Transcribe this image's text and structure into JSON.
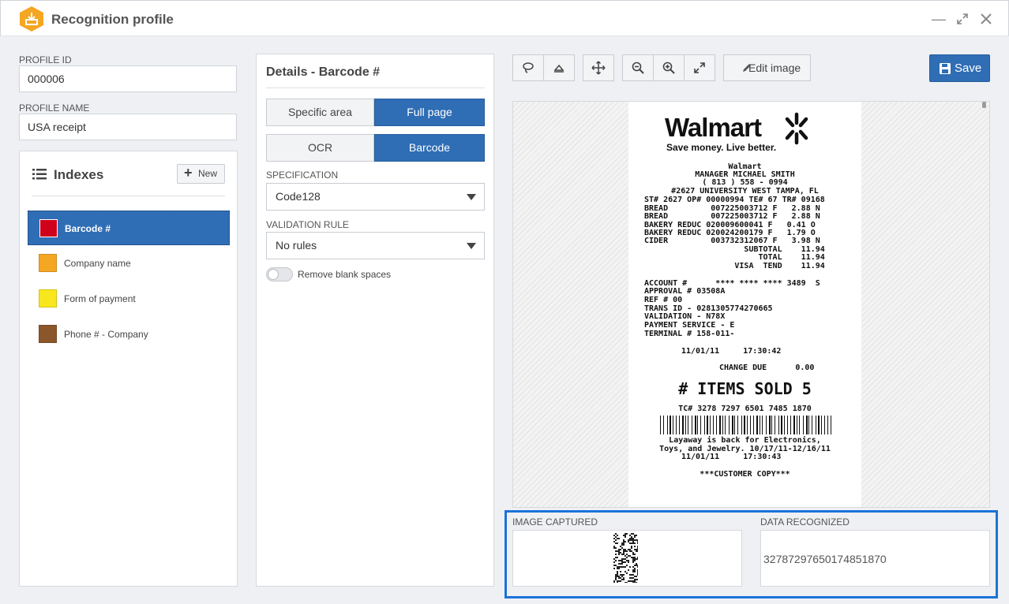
{
  "window": {
    "title": "Recognition profile"
  },
  "profile": {
    "id_label": "PROFILE ID",
    "id_value": "000006",
    "name_label": "PROFILE NAME",
    "name_value": "USA receipt"
  },
  "indexes": {
    "title": "Indexes",
    "new_label": "New",
    "items": [
      {
        "label": "Barcode #",
        "color": "#d0021b"
      },
      {
        "label": "Company name",
        "color": "#f5a623"
      },
      {
        "label": "Form of payment",
        "color": "#f8e71c"
      },
      {
        "label": "Phone # - Company",
        "color": "#8b572a"
      }
    ]
  },
  "details": {
    "title": "Details - Barcode #",
    "area_options": [
      "Specific area",
      "Full page"
    ],
    "area_selected": "Full page",
    "type_options": [
      "OCR",
      "Barcode"
    ],
    "type_selected": "Barcode",
    "specification_label": "SPECIFICATION",
    "specification_value": "Code128",
    "validation_label": "VALIDATION RULE",
    "validation_value": "No rules",
    "remove_blank_label": "Remove blank spaces",
    "remove_blank_on": false
  },
  "toolbar": {
    "edit_label": "Edit image",
    "save_label": "Save"
  },
  "receipt": {
    "brand": "Walmart",
    "tagline": "Save money. Live better.",
    "header_lines": [
      "Walmart",
      "MANAGER MICHAEL SMITH",
      "( 813 ) 558 - 0994",
      "#2627 UNIVERSITY WEST TAMPA, FL"
    ],
    "store_line": "ST# 2627 OP# 00000994 TE# 67 TR# 09168",
    "item_lines": [
      "BREAD         007225003712 F   2.88 N",
      "BREAD         007225003712 F   2.88 N",
      "BAKERY REDUC 020009600041 F   0.41 O",
      "BAKERY REDUC 020024200179 F   1.79 O",
      "CIDER         003732312067 F   3.98 N",
      "                     SUBTOTAL    11.94",
      "                        TOTAL    11.94",
      "                   VISA  TEND    11.94"
    ],
    "payment_lines": [
      "ACCOUNT #      **** **** **** 3489  S",
      "APPROVAL # 03508A",
      "REF # 00",
      "TRANS ID - 0281305774270665",
      "VALIDATION - N78X",
      "PAYMENT SERVICE - E",
      "TERMINAL # 158-011-"
    ],
    "datetime": "11/01/11     17:30:42",
    "change_due": "CHANGE DUE      0.00",
    "items_sold": "# ITEMS SOLD 5",
    "tc_line": "TC# 3278 7297 6501 7485 1870",
    "footer_lines": [
      "Layaway is back for Electronics,",
      "Toys, and Jewelry. 10/17/11-12/16/11",
      "11/01/11     17:30:43"
    ],
    "customer_copy": "***CUSTOMER COPY***"
  },
  "output": {
    "image_label": "IMAGE CAPTURED",
    "data_label": "DATA RECOGNIZED",
    "data_value": "32787297650174851870"
  }
}
